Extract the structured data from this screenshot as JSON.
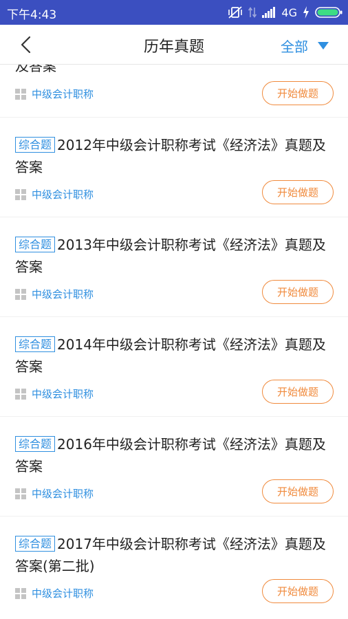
{
  "status": {
    "time": "下午4:43",
    "network": "4G"
  },
  "header": {
    "title": "历年真题",
    "filter_label": "全部"
  },
  "partial_item": {
    "title_tail": "及答案",
    "category": "中级会计职称",
    "button": "开始做题"
  },
  "items": [
    {
      "tag": "综合题",
      "title": "2012年中级会计职称考试《经济法》真题及答案",
      "category": "中级会计职称",
      "button": "开始做题"
    },
    {
      "tag": "综合题",
      "title": "2013年中级会计职称考试《经济法》真题及答案",
      "category": "中级会计职称",
      "button": "开始做题"
    },
    {
      "tag": "综合题",
      "title": "2014年中级会计职称考试《经济法》真题及答案",
      "category": "中级会计职称",
      "button": "开始做题"
    },
    {
      "tag": "综合题",
      "title": "2016年中级会计职称考试《经济法》真题及答案",
      "category": "中级会计职称",
      "button": "开始做题"
    },
    {
      "tag": "综合题",
      "title": "2017年中级会计职称考试《经济法》真题及答案(第二批)",
      "category": "中级会计职称",
      "button": "开始做题"
    }
  ]
}
